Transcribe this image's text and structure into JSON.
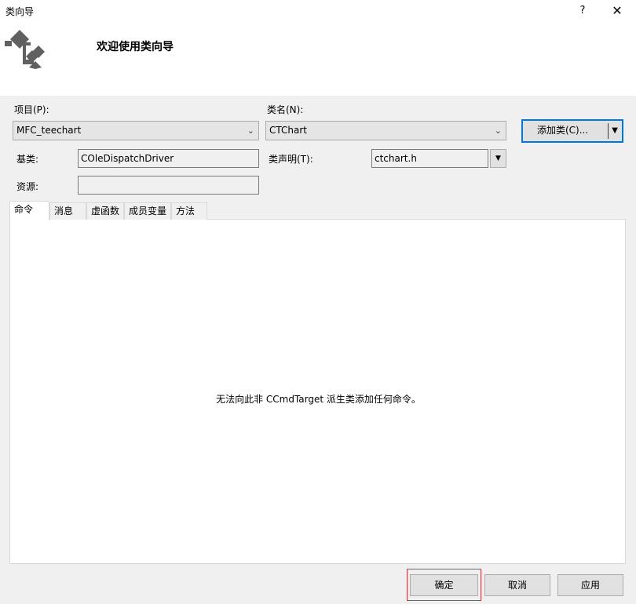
{
  "window": {
    "title": "类向导",
    "help_label": "?",
    "close_label": "✕"
  },
  "header": {
    "heading": "欢迎使用类向导"
  },
  "form": {
    "project_label": "项目(P):",
    "project_value": "MFC_teechart",
    "class_name_label": "类名(N):",
    "class_name_value": "CTChart",
    "add_class_label": "添加类(C)...",
    "base_class_label": "基类:",
    "base_class_value": "COleDispatchDriver",
    "class_decl_label": "类声明(T):",
    "class_decl_value": "ctchart.h",
    "resource_label": "资源:",
    "resource_value": ""
  },
  "tabs": [
    {
      "label": "命令",
      "active": true
    },
    {
      "label": "消息",
      "active": false
    },
    {
      "label": "虚函数",
      "active": false
    },
    {
      "label": "成员变量",
      "active": false
    },
    {
      "label": "方法",
      "active": false
    }
  ],
  "panel": {
    "message": "无法向此非 CCmdTarget 派生类添加任何命令。"
  },
  "footer": {
    "ok_label": "确定",
    "cancel_label": "取消",
    "apply_label": "应用"
  },
  "colors": {
    "accent": "#0078d7",
    "highlight_box": "#d9363e"
  },
  "icons": {
    "wizard": "class-wizard-icon",
    "chevron": "chevron-down-icon",
    "dropdown": "dropdown-arrow-icon"
  }
}
